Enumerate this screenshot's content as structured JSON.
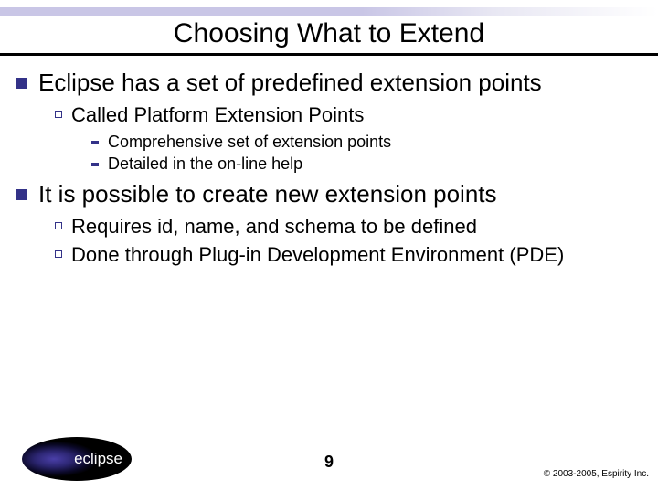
{
  "title": "Choosing What to Extend",
  "bullets": [
    {
      "text": "Eclipse has a set of predefined extension points",
      "children": [
        {
          "text": "Called Platform Extension Points",
          "children": [
            {
              "text": "Comprehensive set of extension points"
            },
            {
              "text": "Detailed in the on-line help"
            }
          ]
        }
      ]
    },
    {
      "text": "It is possible to create new extension points",
      "children": [
        {
          "text": "Requires id, name, and schema to be defined"
        },
        {
          "text": "Done through Plug-in Development Environment (PDE)"
        }
      ]
    }
  ],
  "logo_text": "eclipse",
  "page_number": "9",
  "copyright": "© 2003-2005, Espirity Inc."
}
